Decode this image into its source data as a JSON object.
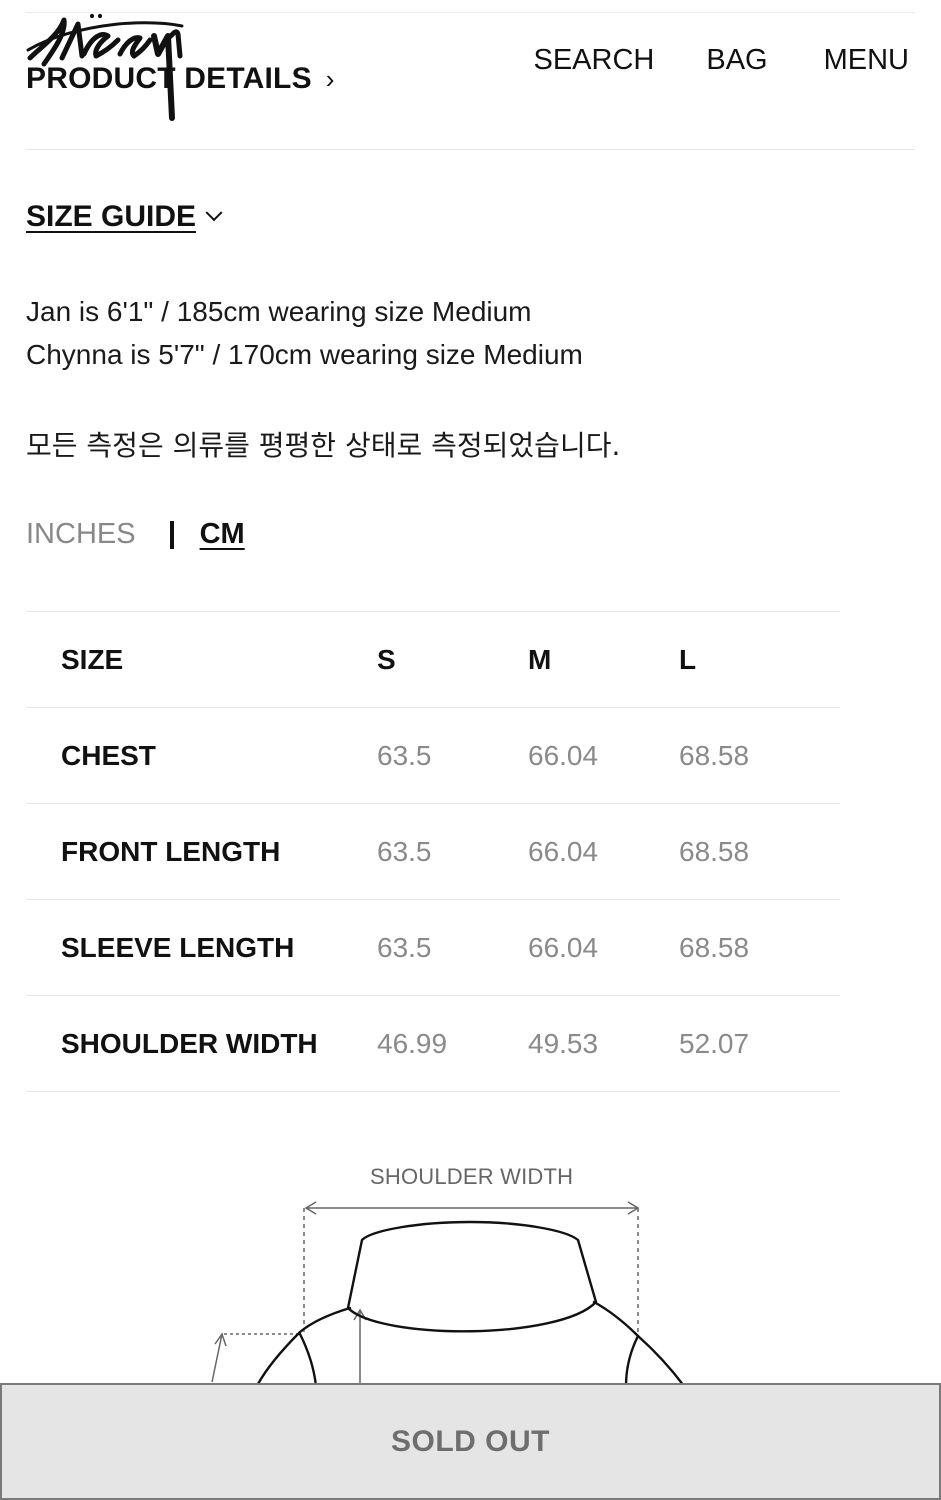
{
  "header": {
    "brand": "Stüssy",
    "product_details_label": "PRODUCT DETAILS",
    "nav": {
      "search": "SEARCH",
      "bag": "BAG",
      "menu": "MENU"
    }
  },
  "size_guide": {
    "title": "SIZE GUIDE",
    "model_info": [
      "Jan is 6'1\" / 185cm wearing size Medium",
      "Chynna is 5'7\" / 170cm wearing size Medium"
    ],
    "measure_note": "모든 측정은 의류를 평평한 상태로 측정되었습니다.",
    "units": {
      "inches": "INCHES",
      "cm": "CM",
      "selected": "CM"
    },
    "table": {
      "header": [
        "SIZE",
        "S",
        "M",
        "L"
      ],
      "rows": [
        [
          "CHEST",
          "63.5",
          "66.04",
          "68.58"
        ],
        [
          "FRONT LENGTH",
          "63.5",
          "66.04",
          "68.58"
        ],
        [
          "SLEEVE LENGTH",
          "63.5",
          "66.04",
          "68.58"
        ],
        [
          "SHOULDER WIDTH",
          "46.99",
          "49.53",
          "52.07"
        ]
      ]
    },
    "diagram_label": "SHOULDER WIDTH"
  },
  "footer": {
    "sold_out": "SOLD OUT"
  }
}
